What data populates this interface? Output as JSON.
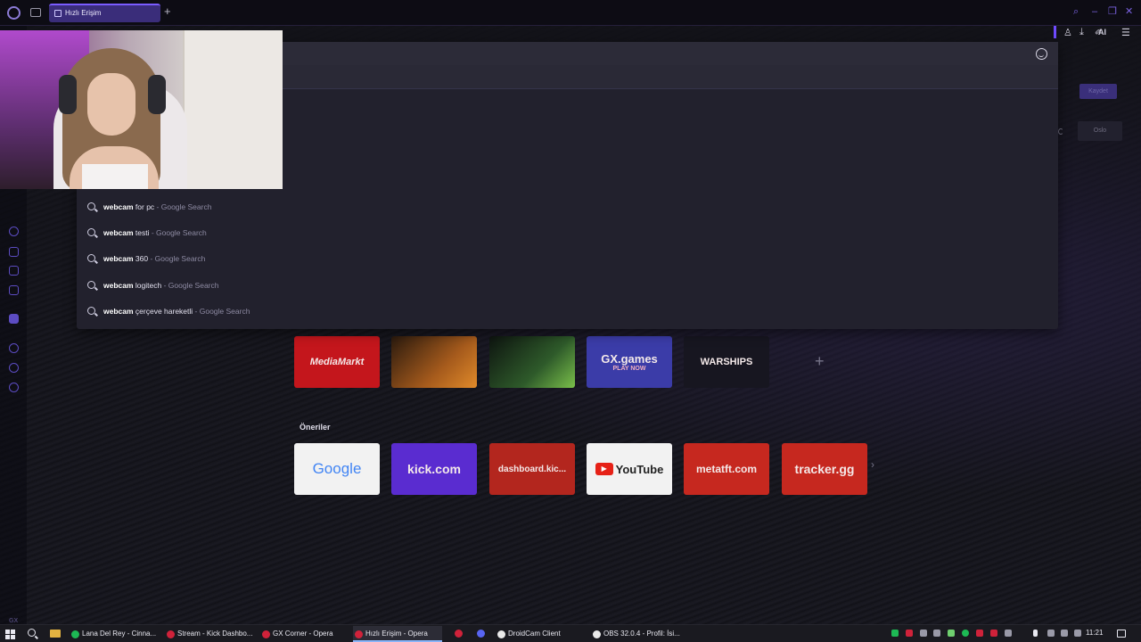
{
  "tab": {
    "label": "Hızlı Erişim"
  },
  "toolbar": {
    "ai_label": "AI"
  },
  "suggestions": [
    {
      "bold": "webcam",
      "rest": " for pc",
      "source": " - Google Search"
    },
    {
      "bold": "webcam",
      "rest": " testi",
      "source": " - Google Search"
    },
    {
      "bold": "webcam",
      "rest": " 360",
      "source": " - Google Search"
    },
    {
      "bold": "webcam",
      "rest": " logitech",
      "source": " - Google Search"
    },
    {
      "bold": "webcam",
      "rest": " çerçeve hareketli",
      "source": " - Google Search"
    }
  ],
  "right_panel": {
    "save_label": "Kaydet",
    "city": "Oslo"
  },
  "speed_dials_top": [
    {
      "label": "MediaMarkt",
      "bg": "#c4161c"
    },
    {
      "label": "",
      "bg": "#3a2412"
    },
    {
      "label": "",
      "bg": "#14201a"
    },
    {
      "label": "GX.games",
      "sub": "PLAY NOW",
      "bg": "#3b3ca8"
    },
    {
      "label": "WARSHIPS",
      "bg": "#171620"
    }
  ],
  "section": {
    "suggestions_title": "Öneriler"
  },
  "speed_dials_bottom": [
    {
      "label": "Google",
      "bg": "#f2f2f2"
    },
    {
      "label": "kick.com",
      "bg": "#5a2cd0"
    },
    {
      "label": "dashboard.kic...",
      "bg": "#b3261e"
    },
    {
      "label": "YouTube",
      "bg": "#f2f2f2"
    },
    {
      "label": "metatft.com",
      "bg": "#c6281f"
    },
    {
      "label": "tracker.gg",
      "bg": "#c6281f"
    }
  ],
  "sidebar": {
    "gx_label": "GX",
    "more": "···"
  },
  "taskbar": {
    "apps": [
      {
        "label": "Lana Del Rey - Cinna...",
        "color": "#1db954"
      },
      {
        "label": "Stream - Kick Dashbo...",
        "color": "#d0223a"
      },
      {
        "label": "GX Corner - Opera",
        "color": "#d0223a"
      },
      {
        "label": "Hızlı Erişim - Opera",
        "color": "#d0223a"
      },
      {
        "label": "DroidCam Client",
        "color": "#eaeaea"
      },
      {
        "label": "OBS 32.0.4 - Profil: İsi...",
        "color": "#eaeaea"
      }
    ],
    "clock": "11:21"
  }
}
